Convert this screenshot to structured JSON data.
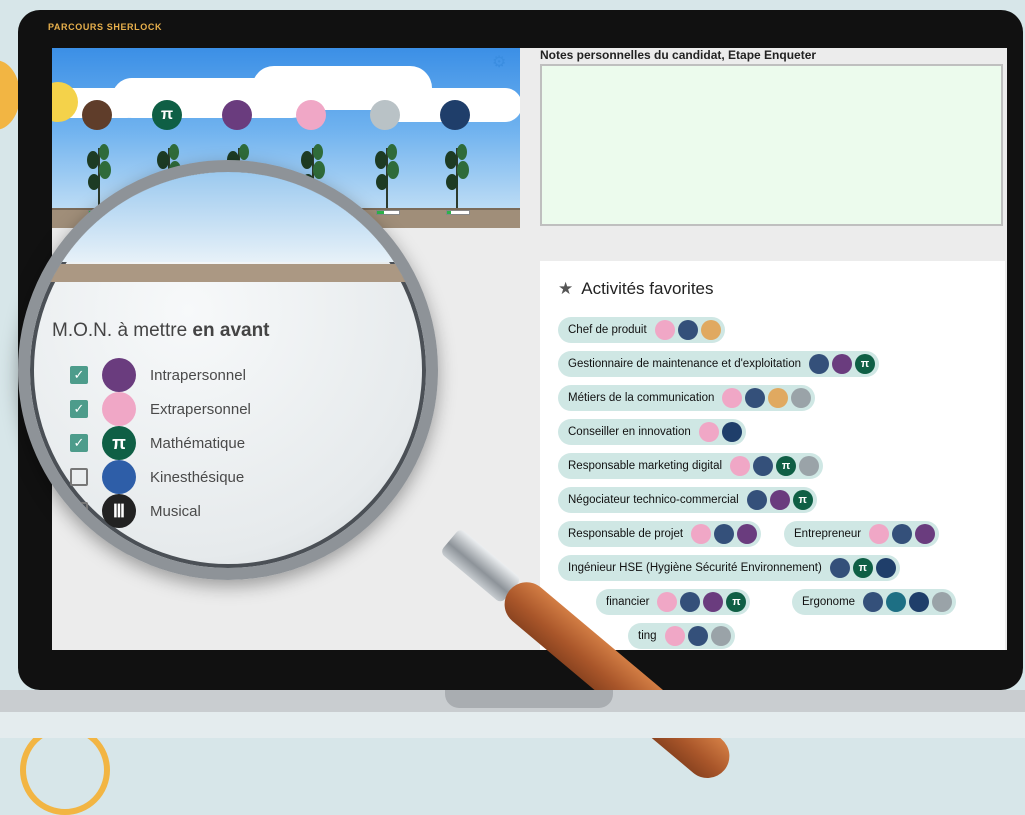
{
  "brand": "PARCOURS SHERLOCK",
  "colors": {
    "accent": "#e8b04c",
    "chip_bg": "#cfe7e4",
    "notes_bg": "#ecfbed"
  },
  "notes": {
    "title": "Notes personnelles du candidat, Etape Enqueter"
  },
  "garden": {
    "medals": [
      {
        "name": "naturaliste",
        "symbol": "",
        "color": "#5f3d2a"
      },
      {
        "name": "mathematique",
        "symbol": "π",
        "color": "#0f5f45"
      },
      {
        "name": "intrapersonnel",
        "symbol": "",
        "color": "#6a3c7e"
      },
      {
        "name": "extrapersonnel",
        "symbol": "",
        "color": "#f0a7c6"
      },
      {
        "name": "spatial",
        "symbol": "",
        "color": "#b9c2c6"
      },
      {
        "name": "existentiel",
        "symbol": "",
        "color": "#1f3e6a"
      }
    ],
    "meter_levels": [
      0.5,
      0.4,
      0.3,
      0.2,
      0.3,
      0.2
    ]
  },
  "favorites": {
    "title": "Activités favorites",
    "items": [
      {
        "label": "Chef de produit",
        "icons": [
          "pink",
          "blue",
          "gold"
        ]
      },
      {
        "label": "Gestionnaire de maintenance et d'exploitation",
        "icons": [
          "blue",
          "purple",
          "green"
        ]
      },
      {
        "label": "Métiers de la communication",
        "icons": [
          "pink",
          "blue",
          "gold",
          "grey"
        ]
      },
      {
        "label": "Conseiller en innovation",
        "icons": [
          "pink",
          "navy"
        ]
      },
      {
        "label": "Responsable marketing digital",
        "icons": [
          "pink",
          "blue",
          "green",
          "grey"
        ]
      },
      {
        "label": "Négociateur technico-commercial",
        "icons": [
          "blue",
          "purple",
          "green"
        ]
      },
      {
        "label": "Responsable de projet",
        "icons": [
          "pink",
          "blue",
          "purple"
        ]
      },
      {
        "label": "Entrepreneur",
        "icons": [
          "pink",
          "blue",
          "purple"
        ]
      },
      {
        "label": "Ingénieur HSE (Hygiène Sécurité Environnement)",
        "icons": [
          "blue",
          "green",
          "navy"
        ]
      },
      {
        "label": "financier",
        "icons": [
          "pink",
          "blue",
          "purple",
          "green"
        ]
      },
      {
        "label": "Ergonome",
        "icons": [
          "blue",
          "teal",
          "navy",
          "grey"
        ]
      },
      {
        "label": "ting",
        "icons": [
          "pink",
          "blue",
          "grey"
        ]
      }
    ]
  },
  "moon": {
    "title_prefix": "M.O.N. à mettre",
    "title_bold": "en avant",
    "items": [
      {
        "label": "Intrapersonnel",
        "checked": true,
        "symbol": "",
        "color": "#6a3c7e"
      },
      {
        "label": "Extrapersonnel",
        "checked": true,
        "symbol": "",
        "color": "#f0a7c6"
      },
      {
        "label": "Mathématique",
        "checked": true,
        "symbol": "π",
        "color": "#0f5f45"
      },
      {
        "label": "Kinesthésique",
        "checked": false,
        "symbol": "",
        "color": "#2e5ea8"
      },
      {
        "label": "Musical",
        "checked": false,
        "symbol": "Ⅲ",
        "color": "#222"
      }
    ]
  }
}
